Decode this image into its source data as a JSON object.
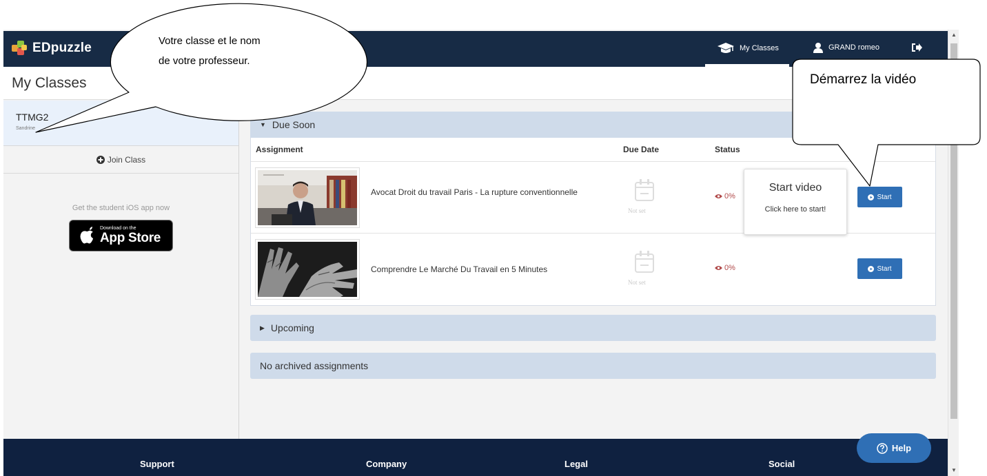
{
  "navbar": {
    "logo_text": "EDpuzzle",
    "my_classes_label": "My Classes",
    "user_name": "GRAND romeo"
  },
  "page_title": "My Classes",
  "sidebar": {
    "class_name": "TTMG2",
    "teacher_name": "Sandrine",
    "join_class_label": "Join Class",
    "ios_prompt": "Get the student iOS app now",
    "appstore_small": "Download on the",
    "appstore_big": "App Store"
  },
  "due_soon": {
    "heading": "Due Soon",
    "columns": {
      "assignment": "Assignment",
      "due_date": "Due Date",
      "status": "Status"
    },
    "assignments": [
      {
        "title": "Avocat Droit du travail Paris - La rupture conventionnelle",
        "due_date": "Not set",
        "status": "0%",
        "action": "Start"
      },
      {
        "title": "Comprendre Le Marché Du Travail en 5 Minutes",
        "due_date": "Not set",
        "status": "0%",
        "action": "Start"
      }
    ]
  },
  "tooltip": {
    "title": "Start video",
    "text": "Click here to start!"
  },
  "upcoming_heading": "Upcoming",
  "archived_heading": "No archived assignments",
  "footer": {
    "support": "Support",
    "company": "Company",
    "legal": "Legal",
    "social": "Social"
  },
  "help_label": "Help",
  "annotations": {
    "bubble_line1": "Votre classe et le nom",
    "bubble_line2": "de votre professeur.",
    "box_text": "Démarrez la vidéo"
  },
  "colors": {
    "navbar": "#172b45",
    "footer": "#0f2140",
    "accent_button": "#2f6fb5",
    "panel_header": "#cfdbea",
    "status_red": "#b14a4a"
  }
}
